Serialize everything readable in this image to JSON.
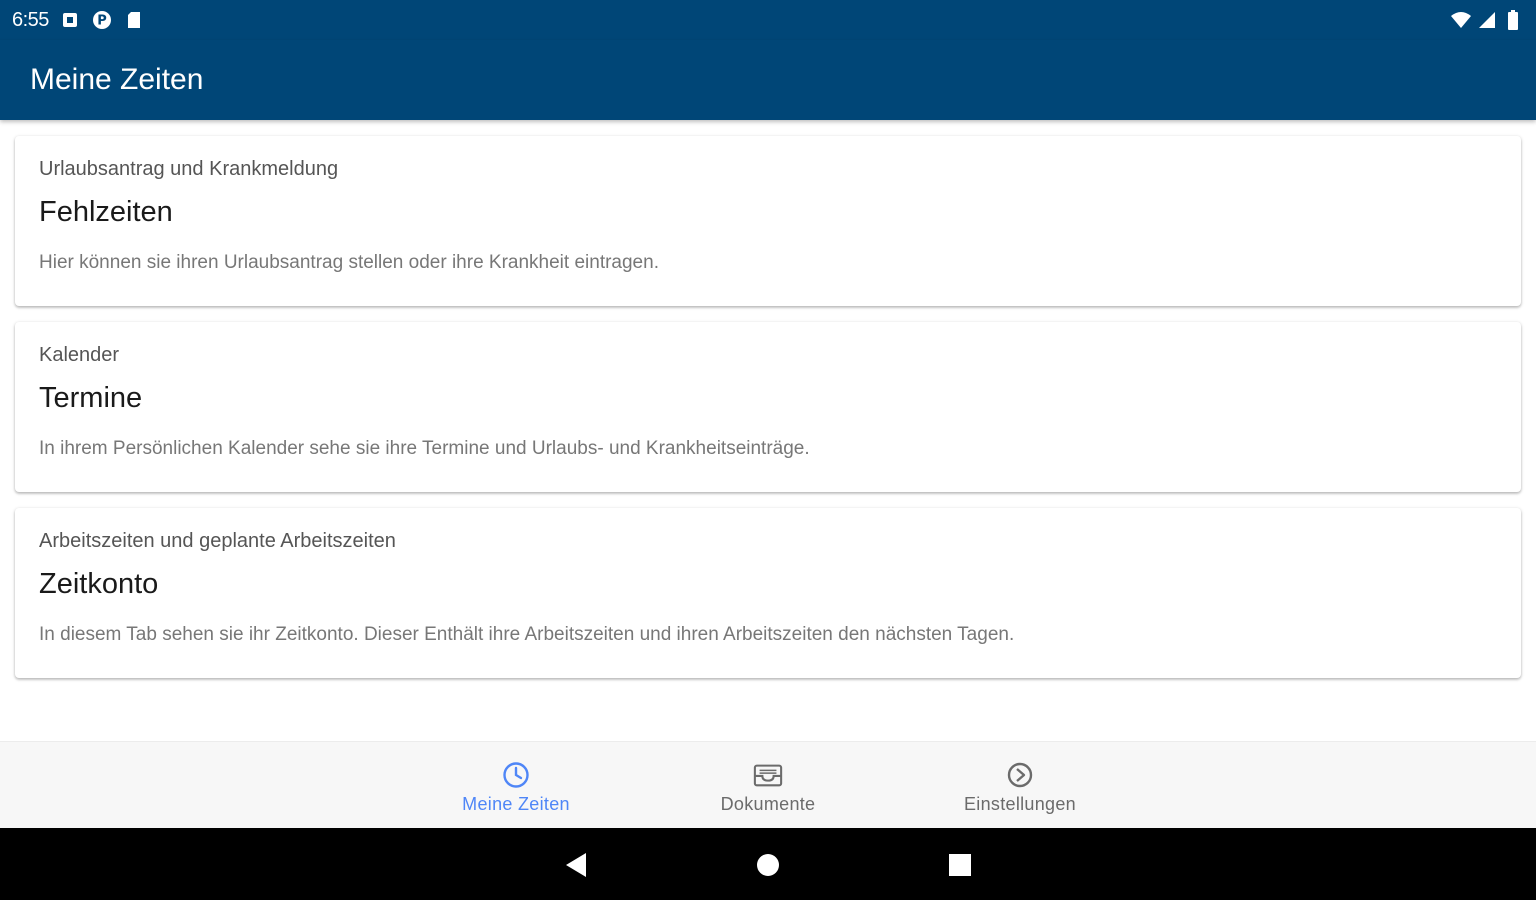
{
  "status_bar": {
    "time": "6:55",
    "left_icons": [
      "notification-icon",
      "p-icon",
      "sd-card-icon"
    ],
    "right_icons": [
      "wifi-icon",
      "signal-icon",
      "battery-icon"
    ]
  },
  "app_bar": {
    "title": "Meine Zeiten",
    "color": "#004677"
  },
  "cards": [
    {
      "overline": "Urlaubsantrag und Krankmeldung",
      "title": "Fehlzeiten",
      "description": "Hier können sie ihren Urlaubsantrag stellen oder ihre Krankheit eintragen."
    },
    {
      "overline": "Kalender",
      "title": "Termine",
      "description": "In ihrem Persönlichen Kalender sehe sie ihre Termine und Urlaubs- und Krankheitseinträge."
    },
    {
      "overline": "Arbeitszeiten und geplante Arbeitszeiten",
      "title": "Zeitkonto",
      "description": "In diesem Tab sehen sie ihr Zeitkonto. Dieser Enthält ihre Arbeitszeiten und ihren Arbeitszeiten den nächsten Tagen."
    }
  ],
  "bottom_nav": {
    "items": [
      {
        "label": "Meine Zeiten",
        "icon": "clock-icon",
        "active": true
      },
      {
        "label": "Dokumente",
        "icon": "inbox-icon",
        "active": false
      },
      {
        "label": "Einstellungen",
        "icon": "settings-icon",
        "active": false
      }
    ],
    "active_color": "#4f86f7",
    "inactive_color": "#6b6b6b"
  },
  "system_nav": {
    "buttons": [
      "back-icon",
      "home-icon",
      "recents-icon"
    ]
  }
}
